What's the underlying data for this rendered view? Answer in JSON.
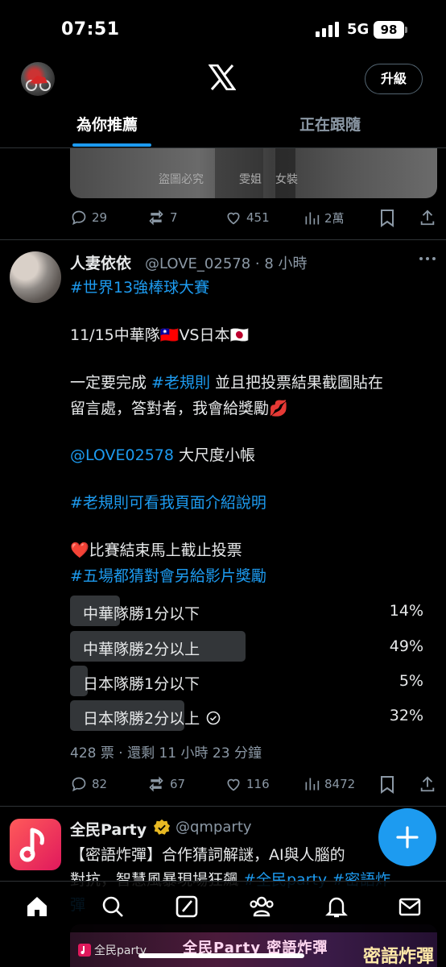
{
  "status_bar": {
    "time": "07:51",
    "network": "5G",
    "battery": "98"
  },
  "header": {
    "upgrade_label": "升級",
    "tabs": [
      {
        "label": "為你推薦",
        "active": true
      },
      {
        "label": "正在跟隨",
        "active": false
      }
    ]
  },
  "prev_tweet": {
    "media_watermarks": [
      "盜圖必究",
      "雯姐",
      "女裝"
    ],
    "actions": {
      "replies": "29",
      "reposts": "7",
      "likes": "451",
      "views": "2萬"
    }
  },
  "tweet": {
    "author_name": "人妻依依",
    "handle_time": "@LOVE_02578 · 8 小時",
    "line1": "#世界13強棒球大賽",
    "line2_a": "11/15中華隊",
    "line2_flag1": "🇹🇼",
    "line2_b": "VS日本",
    "line2_flag2": "🇯🇵",
    "line3_a": "一定要完成 ",
    "line3_hashtag": "#老規則",
    "line3_b": " 並且把投票結果截圖貼在",
    "line4": "留言處，答對者，我會給獎勵💋",
    "line5_mention": "@LOVE02578",
    "line5_b": " 大尺度小帳",
    "line6": "#老規則可看我頁面介紹說明",
    "line7_heart": "❤️",
    "line7_b": "比賽結束馬上截止投票",
    "line8": "#五場都猜對會另給影片獎勵",
    "poll": {
      "options": [
        {
          "label": "中華隊勝1分以下",
          "percent": "14%",
          "value": 14,
          "selected": false
        },
        {
          "label": "中華隊勝2分以上",
          "percent": "49%",
          "value": 49,
          "selected": false
        },
        {
          "label": "日本隊勝1分以下",
          "percent": "5%",
          "value": 5,
          "selected": false
        },
        {
          "label": "日本隊勝2分以上",
          "percent": "32%",
          "value": 32,
          "selected": true
        }
      ],
      "meta": "428 票 · 還剩 11 小時 23 分鐘"
    },
    "actions": {
      "replies": "82",
      "reposts": "67",
      "likes": "116",
      "views": "8472"
    }
  },
  "next_tweet": {
    "author_name": "全民Party",
    "handle": "@qmparty",
    "line1": "【密語炸彈】合作猜詞解謎，AI與人腦的",
    "line2_a": "對抗，智慧風暴現場狂飆 ",
    "line2_tags": "#全民party #密語炸",
    "line3": "彈",
    "promo_brand": "全民party",
    "promo_title": "全民Party 密語炸彈",
    "promo_sub": "密語炸彈"
  },
  "colors": {
    "accent": "#1d9bf0",
    "background": "#000000",
    "secondary_text": "#8b98a5"
  }
}
